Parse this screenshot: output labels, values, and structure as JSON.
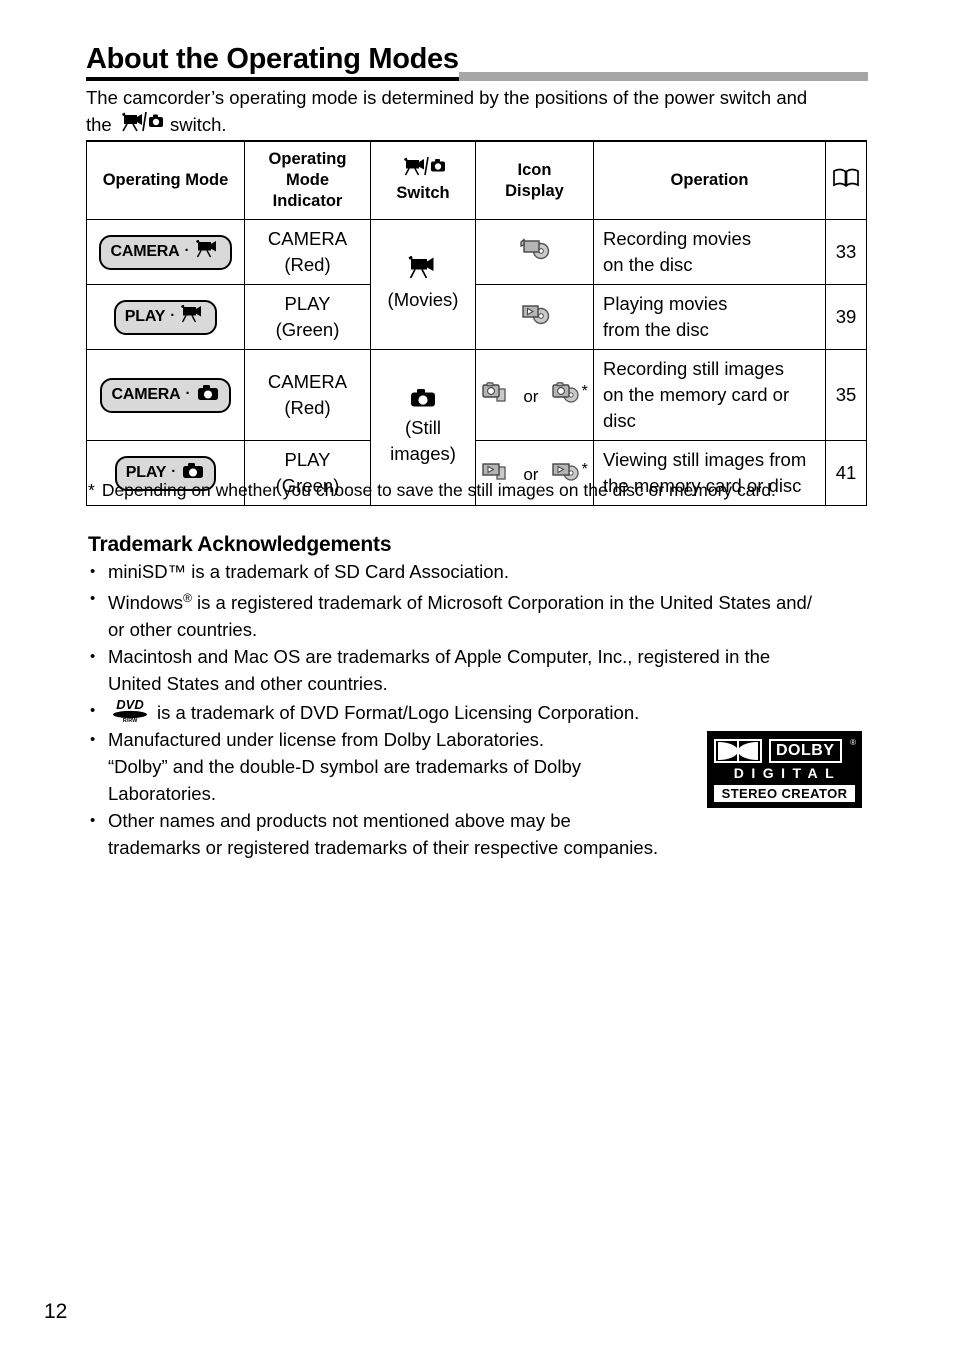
{
  "document": {
    "title": "About the Operating Modes",
    "intro_line1": "The camcorder’s operating mode is determined by the positions of the power switch and",
    "intro_line2_pre": "the",
    "intro_line2_post": "switch.",
    "page_number": "12"
  },
  "table": {
    "headers": {
      "operating_mode": "Operating Mode",
      "mode_indicator": "Operating Mode Indicator",
      "switch_label": "Switch",
      "switch_icon": "movie-camera-still-camera-switch-icon",
      "icon_display_line1": "Icon",
      "icon_display_line2": "Display",
      "operation": "Operation",
      "reference_icon": "open-book-icon"
    },
    "switch_groups": [
      {
        "icon": "movie-camera-icon",
        "label": "(Movies)"
      },
      {
        "icon": "still-camera-icon",
        "label_line1": "(Still",
        "label_line2": "images)"
      }
    ],
    "rows": [
      {
        "badge_text": "CAMERA",
        "badge_icon": "movie-camera-icon",
        "indicator_line1": "CAMERA",
        "indicator_line2": "(Red)",
        "icons": [
          "camcorder-disc-icon"
        ],
        "icon_or": "",
        "icon_star": "",
        "operation_line1": "Recording movies",
        "operation_line2": "on the disc",
        "operation_line3": "",
        "page": "33"
      },
      {
        "badge_text": "PLAY",
        "badge_icon": "movie-camera-icon",
        "indicator_line1": "PLAY",
        "indicator_line2": "(Green)",
        "icons": [
          "play-disc-icon"
        ],
        "icon_or": "",
        "icon_star": "",
        "operation_line1": "Playing movies",
        "operation_line2": "from the disc",
        "operation_line3": "",
        "page": "39"
      },
      {
        "badge_text": "CAMERA",
        "badge_icon": "still-camera-icon",
        "indicator_line1": "CAMERA",
        "indicator_line2": "(Red)",
        "icons": [
          "still-camera-card-icon",
          "still-camera-disc-icon"
        ],
        "icon_or": "or",
        "icon_star": "*",
        "operation_line1": "Recording still images",
        "operation_line2": "on the memory card or",
        "operation_line3": "disc",
        "page": "35"
      },
      {
        "badge_text": "PLAY",
        "badge_icon": "still-camera-icon",
        "indicator_line1": "PLAY",
        "indicator_line2": "(Green)",
        "icons": [
          "play-card-icon",
          "play-disc-small-icon"
        ],
        "icon_or": "or",
        "icon_star": "*",
        "operation_line1": "Viewing still images from",
        "operation_line2": "the memory card or disc",
        "operation_line3": "",
        "page": "41"
      }
    ],
    "badge_separator": "·"
  },
  "footnote": {
    "marker": "*",
    "text": "Depending on whether you choose to save the still images on the disc or memory card."
  },
  "trademarks": {
    "heading": "Trademark Acknowledgements",
    "bullet": "•",
    "items": [
      {
        "lines": [
          "miniSD™ is a trademark of SD Card Association."
        ]
      },
      {
        "lines": [
          "Windows is a registered trademark of Microsoft Corporation in the United States and/",
          "or other countries."
        ],
        "has_registered_mark": true,
        "word_before_mark": "Windows",
        "after_mark": "is a registered trademark of Microsoft Corporation in the United States and/",
        "registered_symbol": "®"
      },
      {
        "lines": [
          "Macintosh and Mac OS are trademarks of Apple Computer, Inc., registered in the",
          "United States and other countries."
        ]
      },
      {
        "has_dvd_logo": true,
        "dvd_logo_name": "dvd-r-rw-logo",
        "dvd_logo_top": "DVD",
        "dvd_logo_bottom": "R/RW",
        "lines": [
          "is a trademark of DVD Format/Logo Licensing Corporation."
        ]
      },
      {
        "lines": [
          "Manufactured under license from Dolby Laboratories.",
          "“Dolby” and the double-D symbol are trademarks of Dolby",
          "Laboratories."
        ]
      },
      {
        "lines": [
          "Other names and products not mentioned above may be",
          "trademarks or registered trademarks of their respective companies."
        ]
      }
    ]
  },
  "dolby_logo": {
    "name": "dolby-digital-stereo-creator-logo",
    "word": "DOLBY",
    "registered": "®",
    "digital": "DIGITAL",
    "stereo_creator": "STEREO CREATOR"
  },
  "colors": {
    "title_rule": "#a6a6a6",
    "badge_fill": "#d9d9d9",
    "icon_gray": "#a8a8a8",
    "text": "#000000"
  }
}
